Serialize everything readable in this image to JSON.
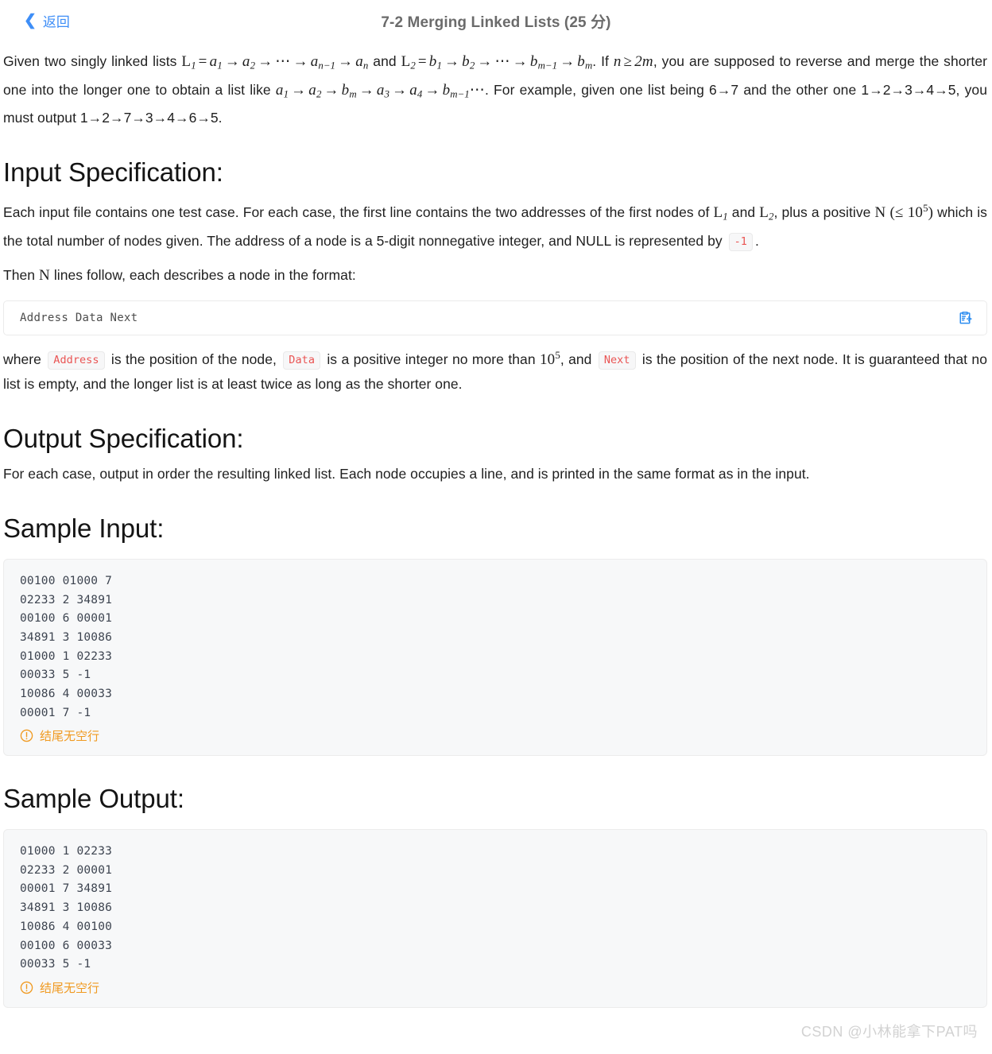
{
  "header": {
    "back_label": "返回",
    "back_icon": "chevron-left-icon",
    "title": "7-2 Merging Linked Lists (25 分)"
  },
  "problem": {
    "intro": {
      "seg1": "Given two singly linked lists ",
      "math_l1": "L₁ = a₁ → a₂ → ⋯ → a₍ₙ₋₁₎ → aₙ",
      "seg2": " and ",
      "math_l2": "L₂ = b₁ → b₂ → ⋯ → b₍ₘ₋₁₎ → bₘ",
      "seg3": ". If ",
      "math_cond": "n ≥ 2m",
      "seg4": ", you are supposed to reverse and merge the shorter one into the longer one to obtain a list like ",
      "math_merge": "a₁ → a₂ → bₘ → a₃ → a₄ → b₍ₘ₋₁₎ ⋯",
      "seg5": ". For example, given one list being 6→7 and the other one 1→2→3→4→5, you must output 1→2→7→3→4→6→5."
    }
  },
  "input_spec": {
    "heading": "Input Specification:",
    "p1_seg1": "Each input file contains one test case. For each case, the first line contains the two addresses of the first nodes of ",
    "p1_l1": "L₁",
    "p1_seg2": " and ",
    "p1_l2": "L₂",
    "p1_seg3": ", plus a positive ",
    "p1_n": "N",
    "p1_seg4": " (≤ 10⁵)",
    "p1_seg5": " which is the total number of nodes given. The address of a node is a 5-digit nonnegative integer, and NULL is represented by ",
    "p1_chip_null": "-1",
    "p1_seg6": ".",
    "p2_seg1": "Then ",
    "p2_n": "N",
    "p2_seg2": " lines follow, each describes a node in the format:",
    "format_code": "Address Data Next",
    "copy_icon": "copy-clipboard-icon",
    "p3_seg1": "where ",
    "p3_chip_address": "Address",
    "p3_seg2": " is the position of the node, ",
    "p3_chip_data": "Data",
    "p3_seg3": " is a positive integer no more than ",
    "p3_pow": "10⁵",
    "p3_seg4": ", and ",
    "p3_chip_next": "Next",
    "p3_seg5": " is the position of the next node. It is guaranteed that no list is empty, and the longer list is at least twice as long as the shorter one."
  },
  "output_spec": {
    "heading": "Output Specification:",
    "text": "For each case, output in order the resulting linked list. Each node occupies a line, and is printed in the same format as in the input."
  },
  "sample_input": {
    "heading": "Sample Input:",
    "code": "00100 01000 7\n02233 2 34891\n00100 6 00001\n34891 3 10086\n01000 1 02233\n00033 5 -1\n10086 4 00033\n00001 7 -1",
    "note": "结尾无空行",
    "note_icon": "exclamation-circle-icon"
  },
  "sample_output": {
    "heading": "Sample Output:",
    "code": "01000 1 02233\n02233 2 00001\n00001 7 34891\n34891 3 10086\n10086 4 00100\n00100 6 00033\n00033 5 -1",
    "note": "结尾无空行",
    "note_icon": "exclamation-circle-icon"
  },
  "watermark": {
    "text": "CSDN @小林能拿下PAT吗"
  },
  "colors": {
    "link": "#3e8ef7",
    "title": "#6b6b6b",
    "code_chip_text": "#ea5453",
    "note": "#f09a21",
    "sample_bg": "#f7f8f9"
  }
}
